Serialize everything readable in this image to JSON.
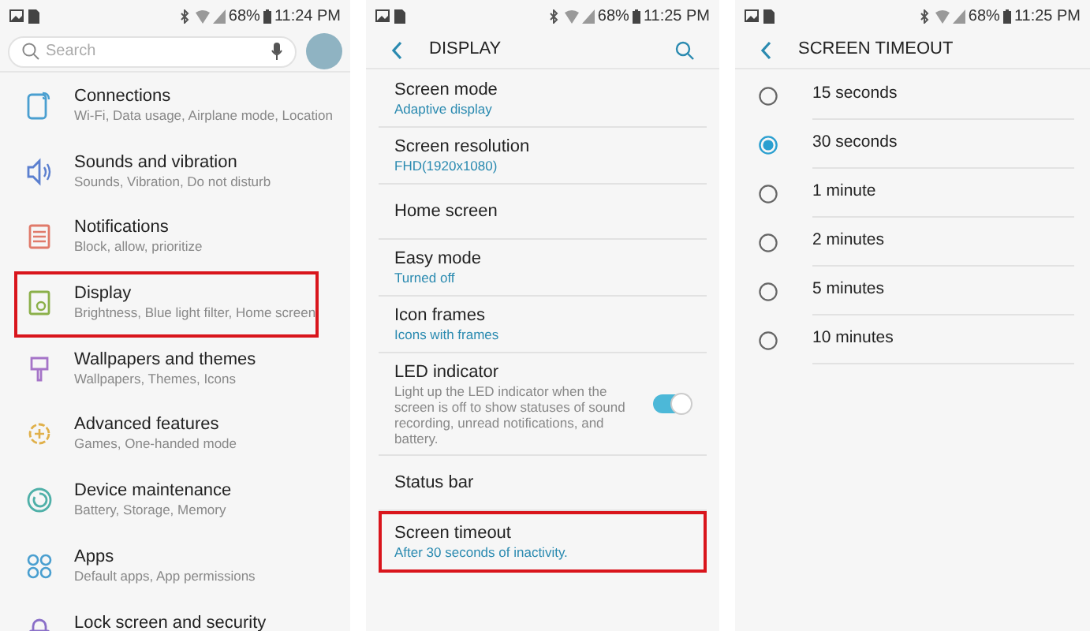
{
  "screens": [
    {
      "status": {
        "battery": "68%",
        "time": "11:24 PM"
      },
      "search": {
        "placeholder": "Search"
      },
      "items": [
        {
          "title": "Connections",
          "subtitle": "Wi-Fi, Data usage, Airplane mode, Location",
          "color": "#4a9fd0",
          "highlighted": false
        },
        {
          "title": "Sounds and vibration",
          "subtitle": "Sounds, Vibration, Do not disturb",
          "color": "#5b7fcf",
          "highlighted": false
        },
        {
          "title": "Notifications",
          "subtitle": "Block, allow, prioritize",
          "color": "#e07a6a",
          "highlighted": false
        },
        {
          "title": "Display",
          "subtitle": "Brightness, Blue light filter, Home screen",
          "color": "#8bb04a",
          "highlighted": true
        },
        {
          "title": "Wallpapers and themes",
          "subtitle": "Wallpapers, Themes, Icons",
          "color": "#a574c8",
          "highlighted": false
        },
        {
          "title": "Advanced features",
          "subtitle": "Games, One-handed mode",
          "color": "#e0b04a",
          "highlighted": false
        },
        {
          "title": "Device maintenance",
          "subtitle": "Battery, Storage, Memory",
          "color": "#4fb0a8",
          "highlighted": false
        },
        {
          "title": "Apps",
          "subtitle": "Default apps, App permissions",
          "color": "#4a9fd0",
          "highlighted": false
        },
        {
          "title": "Lock screen and security",
          "color": "#8a6fc8",
          "highlighted": false
        }
      ]
    },
    {
      "status": {
        "battery": "68%",
        "time": "11:25 PM"
      },
      "title": "DISPLAY",
      "items": [
        {
          "title": "Screen mode",
          "value": "Adaptive display",
          "highlighted": false
        },
        {
          "title": "Screen resolution",
          "value": "FHD(1920x1080)",
          "highlighted": false
        },
        {
          "title": "Home screen",
          "highlighted": false
        },
        {
          "title": "Easy mode",
          "value": "Turned off",
          "highlighted": false
        },
        {
          "title": "Icon frames",
          "value": "Icons with frames",
          "highlighted": false
        },
        {
          "title": "LED indicator",
          "description": "Light up the LED indicator when the screen is off to show statuses of sound recording, unread notifications, and battery.",
          "on": true,
          "highlighted": false
        },
        {
          "title": "Status bar",
          "highlighted": false
        },
        {
          "title": "Screen timeout",
          "value": "After 30 seconds of inactivity.",
          "highlighted": true
        }
      ]
    },
    {
      "status": {
        "battery": "68%",
        "time": "11:25 PM"
      },
      "title": "SCREEN TIMEOUT",
      "options": [
        {
          "label": "15 seconds",
          "selected": false
        },
        {
          "label": "30 seconds",
          "selected": true
        },
        {
          "label": "1 minute",
          "selected": false
        },
        {
          "label": "2 minutes",
          "selected": false
        },
        {
          "label": "5 minutes",
          "selected": false
        },
        {
          "label": "10 minutes",
          "selected": false
        }
      ]
    }
  ]
}
